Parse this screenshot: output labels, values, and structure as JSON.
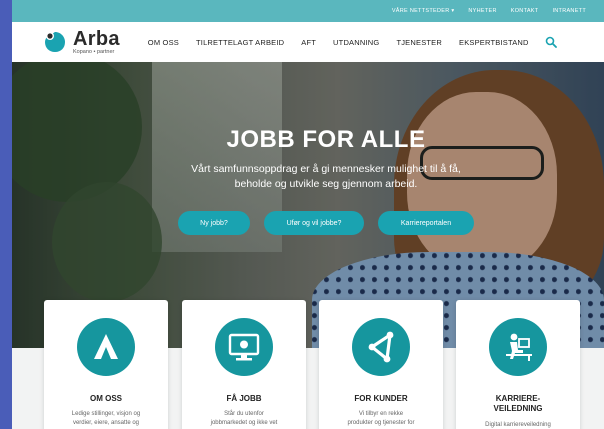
{
  "utility_bar": {
    "links": [
      "VÅRE NETTSTEDER ▾",
      "NYHETER",
      "KONTAKT",
      "INTRANETT"
    ]
  },
  "logo": {
    "name": "Arba",
    "tagline": "Kopano • partner"
  },
  "nav": {
    "items": [
      "OM OSS",
      "TILRETTELAGT ARBEID",
      "AFT",
      "UTDANNING",
      "TJENESTER",
      "EKSPERTBISTAND"
    ]
  },
  "hero": {
    "title": "JOBB FOR ALLE",
    "subtitle_line1": "Vårt samfunnsoppdrag er å gi mennesker mulighet til å få,",
    "subtitle_line2": "beholde og utvikle seg gjennom arbeid.",
    "buttons": [
      "Ny jobb?",
      "Ufør og vil jobbe?",
      "Karriereportalen"
    ]
  },
  "cards": [
    {
      "title": "OM OSS",
      "text_line1": "Ledige stillinger, visjon og",
      "text_line2": "verdier, eiere, ansatte og"
    },
    {
      "title": "FÅ JOBB",
      "text_line1": "Står du utenfor",
      "text_line2": "jobbmarkedet og ikke vet"
    },
    {
      "title": "FOR KUNDER",
      "text_line1": "Vi tilbyr en rekke",
      "text_line2": "produkter og tjenester for"
    },
    {
      "title": "KARRIERE-",
      "title_line2": "VEILEDNING",
      "text_line1": "Digital karriereveiledning",
      "text_line2": ""
    }
  ],
  "colors": {
    "accent": "#1aa3b1",
    "card_icon": "#16969e",
    "utility_bar": "#5ab7be",
    "page_border": "#4a5db8"
  }
}
